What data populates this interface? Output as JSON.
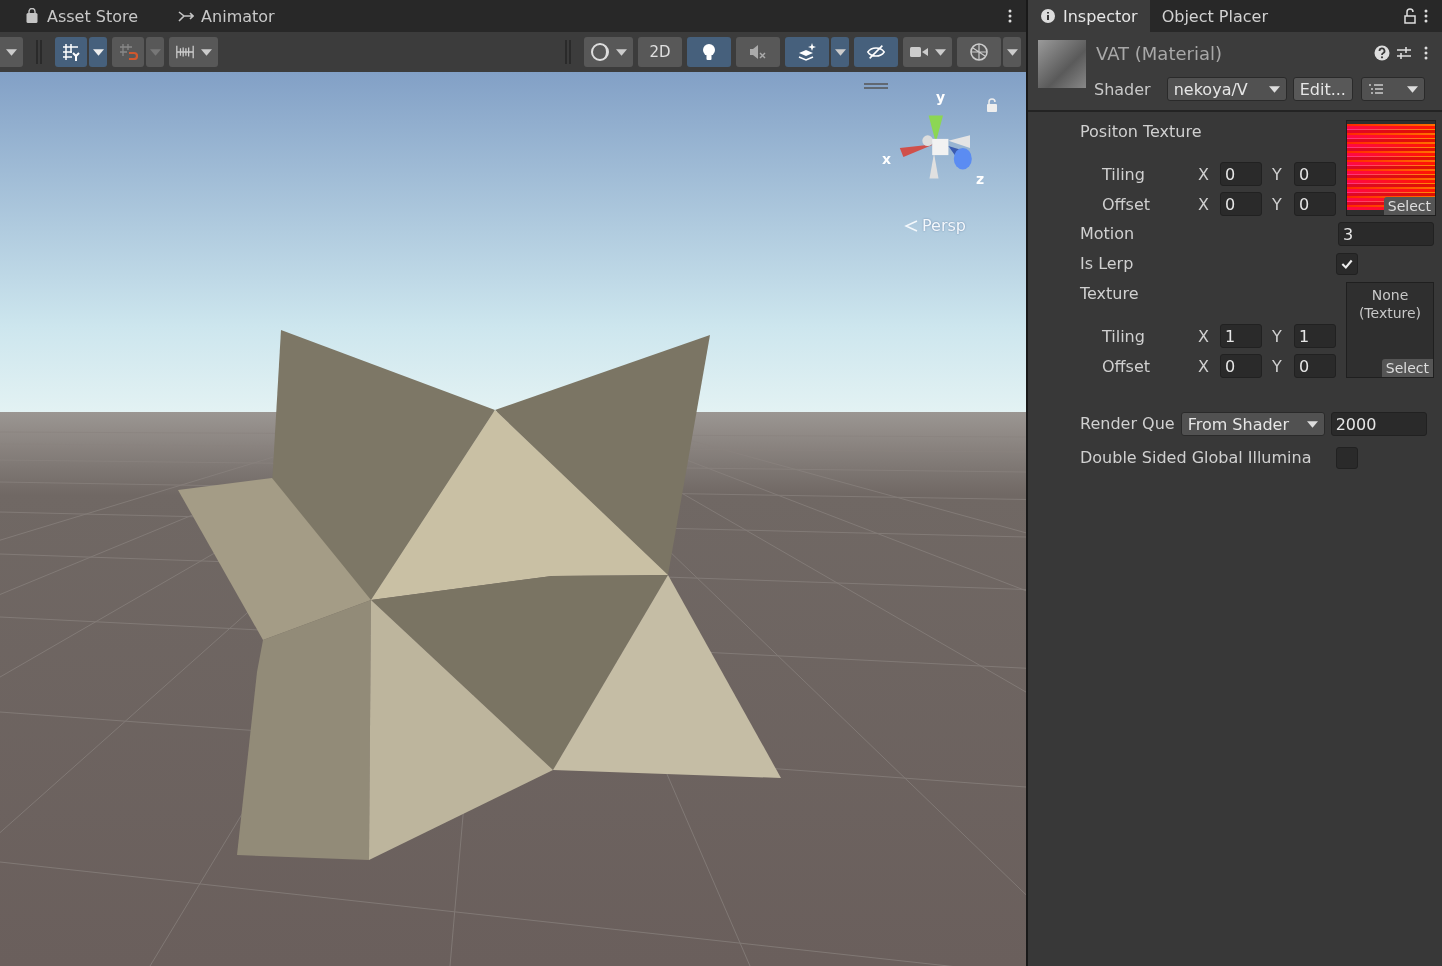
{
  "scene_tabs": [
    {
      "label": "Asset Store",
      "selected": false
    },
    {
      "label": "Animator",
      "selected": false
    }
  ],
  "scene_toolbar": {
    "left": [
      {
        "on": true,
        "dropdown": true
      },
      {
        "on": false,
        "dropdown": true
      },
      {
        "on": false,
        "dropdown": true
      }
    ],
    "right": [
      {
        "on": false,
        "dropdown": true
      },
      {
        "text": "2D",
        "on": false,
        "dropdown": false
      },
      {
        "on": true,
        "dropdown": false
      },
      {
        "on": false,
        "dropdown": false
      },
      {
        "on": true,
        "dropdown": true
      },
      {
        "on": true,
        "dropdown": false
      },
      {
        "on": false,
        "dropdown": true
      },
      {
        "on": false,
        "dropdown": true
      }
    ]
  },
  "viewport": {
    "axes": {
      "x": "x",
      "y": "y",
      "z": "z"
    },
    "projection": "Persp"
  },
  "inspector": {
    "tabs": [
      {
        "label": "Inspector",
        "selected": true
      },
      {
        "label": "Object Placer",
        "selected": false
      }
    ],
    "title": "VAT (Material)",
    "shader_label": "Shader",
    "shader_value": "nekoya/V",
    "edit_button": "Edit...",
    "properties": [
      {
        "kind": "texture",
        "label": "Positon Texture",
        "has_image": true,
        "select": "Select",
        "rows": [
          {
            "label": "Tiling",
            "fields": [
              {
                "axis": "X",
                "value": "0"
              },
              {
                "axis": "Y",
                "value": "0"
              }
            ]
          },
          {
            "label": "Offset",
            "fields": [
              {
                "axis": "X",
                "value": "0"
              },
              {
                "axis": "Y",
                "value": "0"
              }
            ]
          }
        ]
      },
      {
        "kind": "float",
        "label": "Motion",
        "value": "3"
      },
      {
        "kind": "toggle",
        "label": "Is Lerp",
        "checked": true
      },
      {
        "kind": "texture",
        "label": "Texture",
        "has_image": false,
        "empty_text": "None (Texture)",
        "select": "Select",
        "rows": [
          {
            "label": "Tiling",
            "fields": [
              {
                "axis": "X",
                "value": "1"
              },
              {
                "axis": "Y",
                "value": "1"
              }
            ]
          },
          {
            "label": "Offset",
            "fields": [
              {
                "axis": "X",
                "value": "0"
              },
              {
                "axis": "Y",
                "value": "0"
              }
            ]
          }
        ]
      },
      {
        "kind": "queue",
        "label": "Render Que",
        "option": "From Shader",
        "value": "2000"
      },
      {
        "kind": "toggle",
        "label": "Double Sided Global Illumina",
        "checked": false
      }
    ]
  }
}
